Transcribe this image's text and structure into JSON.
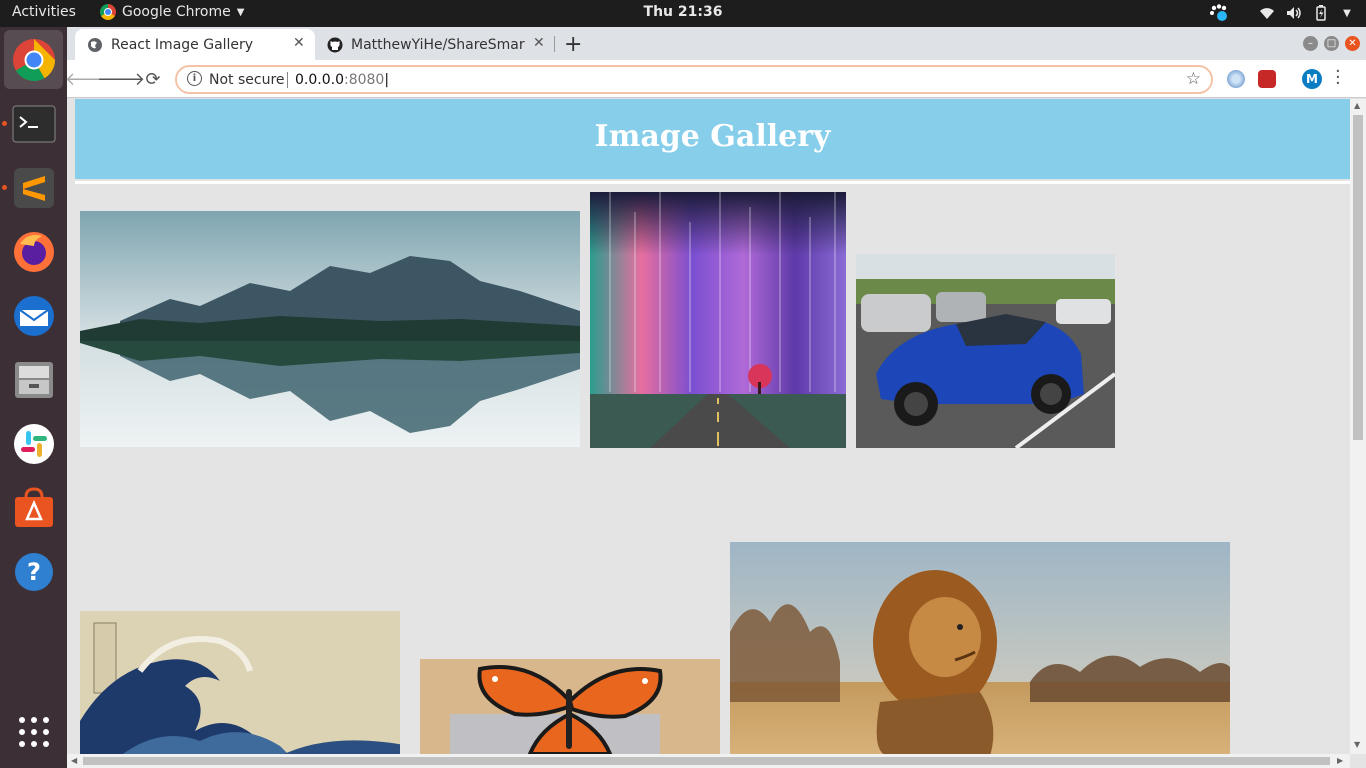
{
  "topbar": {
    "activities": "Activities",
    "app_name": "Google Chrome",
    "clock": "Thu 21:36"
  },
  "dock": {
    "items": [
      "chrome-icon",
      "terminal-icon",
      "sublime-text-icon",
      "firefox-icon",
      "thunderbird-icon",
      "files-icon",
      "slack-icon",
      "software-center-icon",
      "help-icon",
      "show-apps-icon"
    ]
  },
  "browser": {
    "tabs": [
      {
        "title": "React Image Gallery",
        "active": true
      },
      {
        "title": "MatthewYiHe/ShareSmar",
        "active": false
      }
    ],
    "address": {
      "security_label": "Not secure",
      "host": "0.0.0.0",
      "port": ":8080"
    },
    "profile_initial": "M"
  },
  "page": {
    "title": "Image Gallery",
    "images": [
      "mountain-lake",
      "aurora-road",
      "blue-sports-car",
      "great-wave",
      "monarch-butterfly",
      "lion"
    ]
  },
  "colors": {
    "header_bg": "#87ceeb",
    "page_bg": "#e4e4e4",
    "accent": "#e95420"
  }
}
